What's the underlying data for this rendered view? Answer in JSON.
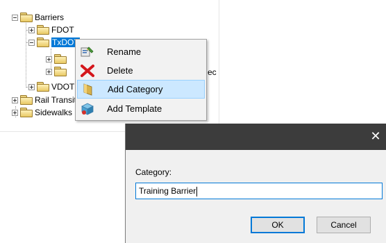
{
  "tree": {
    "root": "Barriers",
    "items": [
      {
        "label": "FDOT"
      },
      {
        "label": "TxDOT"
      },
      {
        "label": "VDOT"
      },
      {
        "label": "Rail Transit"
      },
      {
        "label": "Sidewalks"
      }
    ],
    "partial_text": "ec"
  },
  "context_menu": {
    "items": [
      {
        "label": "Rename",
        "icon": "rename-icon"
      },
      {
        "label": "Delete",
        "icon": "delete-x-icon"
      },
      {
        "label": "Add Category",
        "icon": "add-category-icon"
      },
      {
        "label": "Add Template",
        "icon": "add-template-icon"
      }
    ],
    "highlighted_index": 2
  },
  "dialog": {
    "close_glyph": "✕",
    "field_label": "Category:",
    "input_value": "Training Barrier",
    "ok_label": "OK",
    "cancel_label": "Cancel"
  },
  "colors": {
    "selection": "#0078d7",
    "menu_highlight": "#cce8ff",
    "dialog_title": "#3c3c3c"
  }
}
